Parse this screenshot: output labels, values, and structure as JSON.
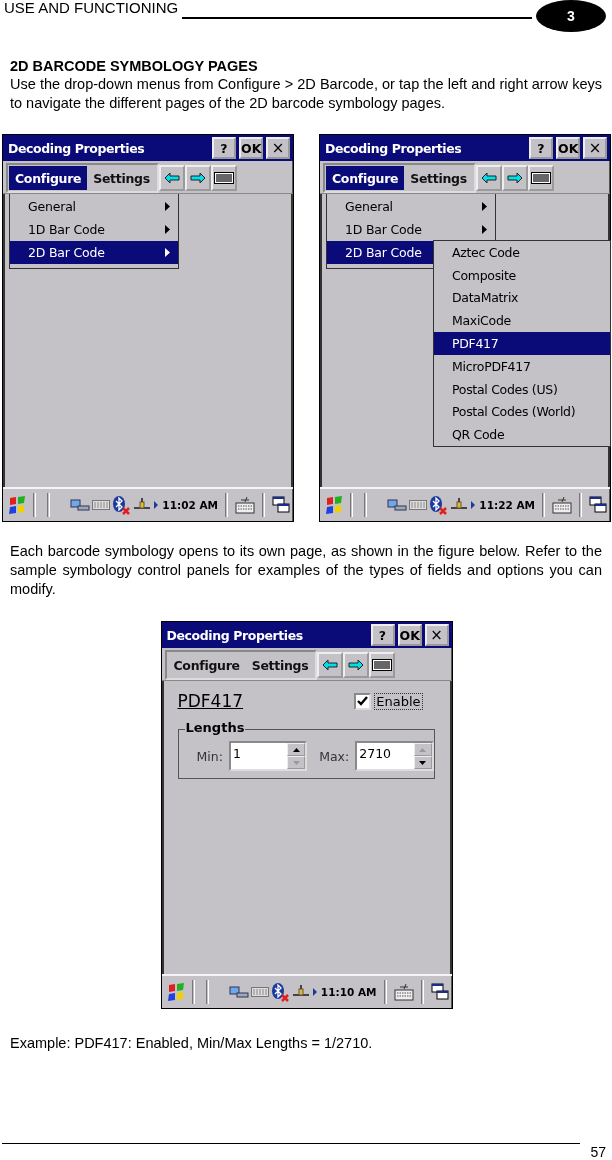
{
  "header": {
    "section": "USE AND FUNCTIONING",
    "chapter": "3"
  },
  "heading": "2D BARCODE SYMBOLOGY PAGES",
  "intro": "Use the drop-down menus from Configure > 2D Barcode, or tap the left and right arrow keys to navigate the different pages of the 2D barcode symbology pages.",
  "screens": [
    {
      "title": "Decoding Properties",
      "help": "?",
      "ok": "OK",
      "close": "×",
      "menu": [
        {
          "label": "Configure",
          "selected": true
        },
        {
          "label": "Settings",
          "selected": false
        }
      ],
      "dropdown": [
        {
          "label": "General",
          "selected": false
        },
        {
          "label": "1D Bar Code",
          "selected": false
        },
        {
          "label": "2D Bar Code",
          "selected": true
        }
      ],
      "time": "11:02 AM"
    },
    {
      "title": "Decoding Properties",
      "help": "?",
      "ok": "OK",
      "close": "×",
      "menu": [
        {
          "label": "Configure",
          "selected": true
        },
        {
          "label": "Settings",
          "selected": false
        }
      ],
      "dropdown": [
        {
          "label": "General",
          "selected": false
        },
        {
          "label": "1D Bar Code",
          "selected": false
        },
        {
          "label": "2D Bar Code",
          "selected": true
        }
      ],
      "submenu": [
        {
          "label": "Aztec Code",
          "selected": false
        },
        {
          "label": "Composite",
          "selected": false
        },
        {
          "label": "DataMatrix",
          "selected": false
        },
        {
          "label": "MaxiCode",
          "selected": false
        },
        {
          "label": "PDF417",
          "selected": true
        },
        {
          "label": "MicroPDF417",
          "selected": false
        },
        {
          "label": "Postal Codes (US)",
          "selected": false
        },
        {
          "label": "Postal Codes (World)",
          "selected": false
        },
        {
          "label": "QR Code",
          "selected": false
        }
      ],
      "time": "11:22 AM"
    }
  ],
  "body": "Each barcode symbology opens to its own page, as shown in the figure below. Refer to the sample symbology control panels for examples of the types of fields and options you can modify.",
  "detail_screen": {
    "title": "Decoding Properties",
    "help": "?",
    "ok": "OK",
    "close": "×",
    "menu": [
      {
        "label": "Configure",
        "selected": false
      },
      {
        "label": "Settings",
        "selected": false
      }
    ],
    "page": {
      "name": "PDF417",
      "enable": {
        "label": "Enable",
        "checked": true
      },
      "group": "Lengths",
      "fields": [
        {
          "label": "Min:",
          "value": "1",
          "up_disabled": false,
          "down_disabled": true
        },
        {
          "label": "Max:",
          "value": "2710",
          "up_disabled": true,
          "down_disabled": false
        }
      ]
    },
    "time": "11:10 AM"
  },
  "caption": "Example: PDF417: Enabled, Min/Max Lengths = 1/2710.",
  "page_number": "57"
}
